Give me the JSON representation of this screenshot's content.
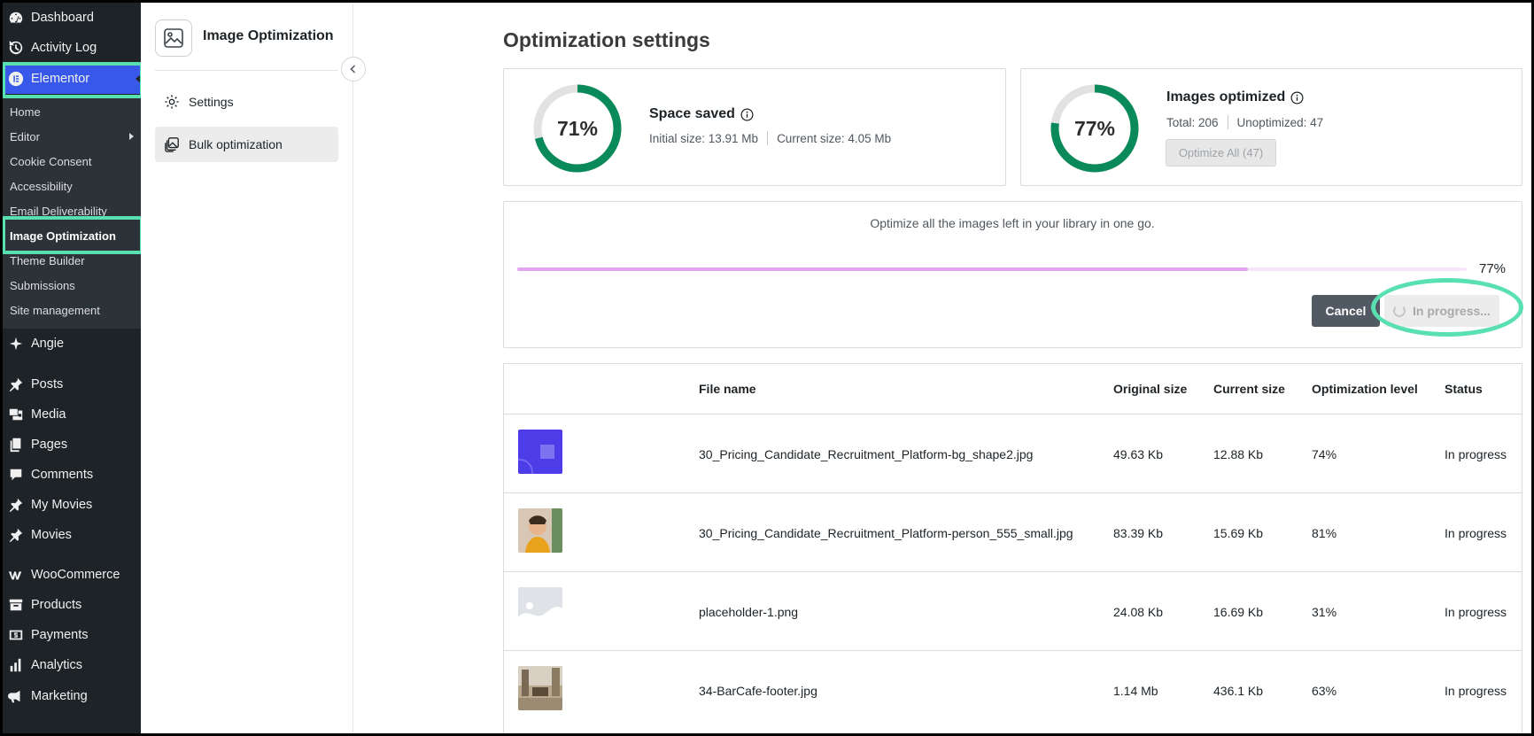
{
  "wp_menu": {
    "top_items": [
      {
        "label": "Dashboard",
        "icon": "dashboard-icon"
      },
      {
        "label": "Activity Log",
        "icon": "history-icon"
      },
      {
        "label": "Elementor",
        "icon": "elementor-icon"
      }
    ],
    "elementor_submenu": [
      {
        "label": "Home"
      },
      {
        "label": "Editor"
      },
      {
        "label": "Cookie Consent"
      },
      {
        "label": "Accessibility"
      },
      {
        "label": "Email Deliverability"
      },
      {
        "label": "Image Optimization"
      },
      {
        "label": "Theme Builder"
      },
      {
        "label": "Submissions"
      },
      {
        "label": "Site management"
      }
    ],
    "bottom_items": [
      {
        "label": "Angie",
        "icon": "sparkle-icon"
      },
      {
        "label": "Posts",
        "icon": "pin-icon"
      },
      {
        "label": "Media",
        "icon": "media-icon"
      },
      {
        "label": "Pages",
        "icon": "pages-icon"
      },
      {
        "label": "Comments",
        "icon": "comment-icon"
      },
      {
        "label": "My Movies",
        "icon": "pin-icon"
      },
      {
        "label": "Movies",
        "icon": "pin-icon"
      },
      {
        "label": "WooCommerce",
        "icon": "woocommerce-icon"
      },
      {
        "label": "Products",
        "icon": "archive-icon"
      },
      {
        "label": "Payments",
        "icon": "payments-icon"
      },
      {
        "label": "Analytics",
        "icon": "bar-chart-icon"
      },
      {
        "label": "Marketing",
        "icon": "megaphone-icon"
      }
    ]
  },
  "plugin": {
    "title": "Image Optimization",
    "nav": [
      {
        "label": "Settings",
        "icon": "gear-icon"
      },
      {
        "label": "Bulk optimization",
        "icon": "images-icon"
      }
    ]
  },
  "main": {
    "title": "Optimization settings",
    "space_saved": {
      "percent_label": "71%",
      "percent": 71,
      "title": "Space saved",
      "initial": "Initial size: 13.91 Mb",
      "current": "Current size: 4.05 Mb"
    },
    "images_optimized": {
      "percent_label": "77%",
      "percent": 77,
      "title": "Images optimized",
      "total": "Total: 206",
      "unoptimized": "Unoptimized: 47",
      "button": "Optimize All (47)"
    },
    "bulk": {
      "description": "Optimize all the images left in your library in one go.",
      "progress_label": "77%",
      "progress": 77,
      "cancel": "Cancel",
      "in_progress": "In progress..."
    },
    "table": {
      "headers": [
        "File name",
        "Original size",
        "Current size",
        "Optimization level",
        "Status"
      ],
      "rows": [
        {
          "file": "30_Pricing_Candidate_Recruitment_Platform-bg_shape2.jpg",
          "original": "49.63 Kb",
          "current": "12.88 Kb",
          "level": "74%",
          "status": "In progress"
        },
        {
          "file": "30_Pricing_Candidate_Recruitment_Platform-person_555_small.jpg",
          "original": "83.39 Kb",
          "current": "15.69 Kb",
          "level": "81%",
          "status": "In progress"
        },
        {
          "file": "placeholder-1.png",
          "original": "24.08 Kb",
          "current": "16.69 Kb",
          "level": "31%",
          "status": "In progress"
        },
        {
          "file": "34-BarCafe-footer.jpg",
          "original": "1.14 Mb",
          "current": "436.1 Kb",
          "level": "63%",
          "status": "In progress"
        }
      ]
    }
  },
  "colors": {
    "accent_green": "#0a8a5a",
    "wp_sidebar": "#1d2327",
    "wp_active": "#3858e9",
    "highlight": "#59e0b0",
    "progress": "#e3a5f0"
  }
}
